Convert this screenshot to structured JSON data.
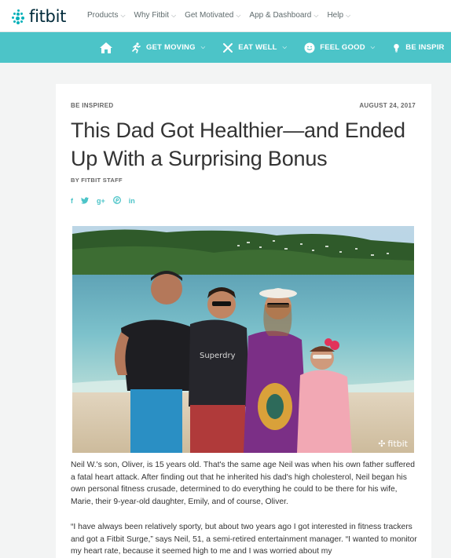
{
  "brand": {
    "name": "fitbit",
    "accent": "#4cc4c8",
    "logo_color": "#00b0b9"
  },
  "top_nav": {
    "items": [
      {
        "label": "Products",
        "icon": "chevron-down-icon"
      },
      {
        "label": "Why Fitbit",
        "icon": "chevron-down-icon"
      },
      {
        "label": "Get Motivated",
        "icon": "chevron-down-icon"
      },
      {
        "label": "App & Dashboard",
        "icon": "chevron-down-icon"
      },
      {
        "label": "Help",
        "icon": "chevron-down-icon"
      }
    ]
  },
  "section_nav": {
    "home_icon": "home-icon",
    "items": [
      {
        "label": "GET MOVING",
        "icon": "running-icon"
      },
      {
        "label": "EAT WELL",
        "icon": "fork-knife-icon"
      },
      {
        "label": "FEEL GOOD",
        "icon": "smile-icon"
      },
      {
        "label": "BE INSPIR",
        "icon": "lightbulb-icon"
      }
    ]
  },
  "article": {
    "category": "BE INSPIRED",
    "date": "AUGUST 24, 2017",
    "title": "This Dad Got Healthier—and Ended Up With a Surprising Bonus",
    "byline": "BY FITBIT STAFF",
    "share_icons": [
      "facebook-icon",
      "twitter-icon",
      "google-plus-icon",
      "pinterest-icon",
      "linkedin-icon"
    ],
    "share_glyphs": {
      "facebook": "f",
      "twitter": "🐦",
      "google_plus": "g+",
      "pinterest": "⊛",
      "linkedin": "in"
    },
    "photo_watermark": "fitbit",
    "paragraphs": [
      "Neil W.'s son, Oliver, is 15 years old. That's the same age Neil was when his own father suffered a fatal heart attack. After finding out that he inherited his dad's high cholesterol, Neil began his own personal fitness crusade, determined to do everything he could to be there for his wife, Marie, their 9-year-old daughter, Emily, and of course, Oliver.",
      "“I have always been relatively sporty, but about two years ago I got interested in fitness trackers and got a Fitbit Surge,” says Neil, 51, a semi-retired entertainment manager. “I wanted to monitor my heart rate, because it seemed high to me and I was worried about my"
    ]
  }
}
